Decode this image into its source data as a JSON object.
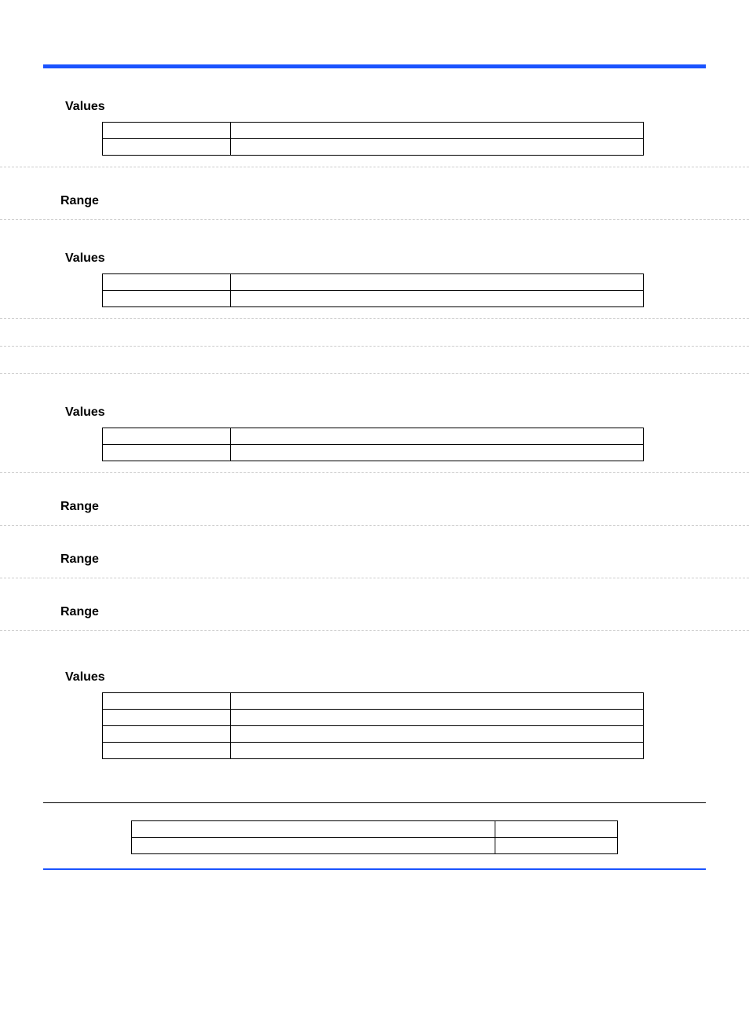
{
  "sections": [
    {
      "label": "Values",
      "rows": 2
    },
    {
      "label": "Range"
    },
    {
      "label": "Values",
      "rows": 2
    },
    {
      "label": "Values",
      "rows": 2
    },
    {
      "label": "Range"
    },
    {
      "label": "Range"
    },
    {
      "label": "Range"
    },
    {
      "label": "Values",
      "rows": 4
    }
  ],
  "labels": {
    "values": "Values",
    "range": "Range"
  }
}
